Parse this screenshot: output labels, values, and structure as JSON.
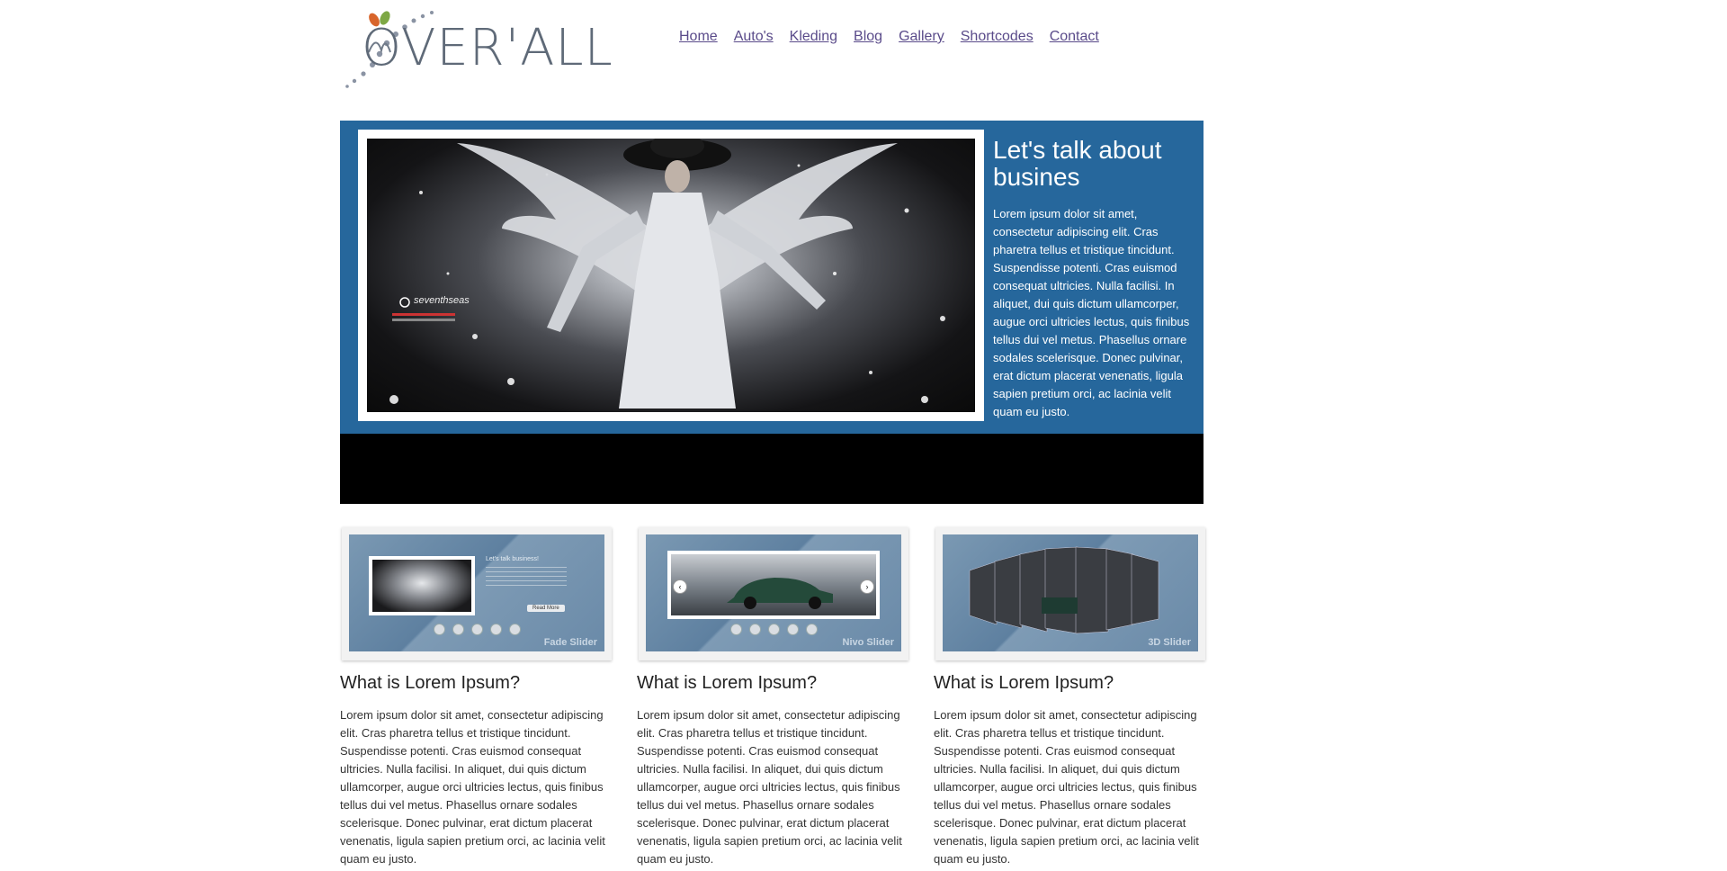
{
  "logo": {
    "text": "OVER'ALL"
  },
  "nav": {
    "items": [
      "Home",
      "Auto's",
      "Kleding",
      "Blog",
      "Gallery",
      "Shortcodes",
      "Contact"
    ]
  },
  "hero": {
    "title": "Let's talk about busines",
    "body": "Lorem ipsum dolor sit amet, consectetur adipiscing elit. Cras pharetra tellus et tristique tincidunt. Suspendisse potenti. Cras euismod consequat ultricies. Nulla facilisi. In aliquet, dui quis dictum ullamcorper, augue orci ultricies lectus, quis finibus tellus dui vel metus. Phasellus ornare sodales scelerisque. Donec pulvinar, erat dictum placerat venenatis, ligula sapien pretium orci, ac lacinia velit quam eu justo.",
    "image_watermark": "seventhseas",
    "colors": {
      "blue": "#26679c",
      "black": "#000000"
    }
  },
  "thumbs": [
    {
      "label": "Fade Slider",
      "mini_title": "Let's talk business!",
      "mini_button": "Read More"
    },
    {
      "label": "Nivo Slider"
    },
    {
      "label": "3D Slider"
    }
  ],
  "columns": [
    {
      "title": "What is Lorem Ipsum?",
      "body": "Lorem ipsum dolor sit amet, consectetur adipiscing elit. Cras pharetra tellus et tristique tincidunt. Suspendisse potenti. Cras euismod consequat ultricies. Nulla facilisi. In aliquet, dui quis dictum ullamcorper, augue orci ultricies lectus, quis finibus tellus dui vel metus. Phasellus ornare sodales scelerisque. Donec pulvinar, erat dictum placerat venenatis, ligula sapien pretium orci, ac lacinia velit quam eu justo."
    },
    {
      "title": "What is Lorem Ipsum?",
      "body": "Lorem ipsum dolor sit amet, consectetur adipiscing elit. Cras pharetra tellus et tristique tincidunt. Suspendisse potenti. Cras euismod consequat ultricies. Nulla facilisi. In aliquet, dui quis dictum ullamcorper, augue orci ultricies lectus, quis finibus tellus dui vel metus. Phasellus ornare sodales scelerisque. Donec pulvinar, erat dictum placerat venenatis, ligula sapien pretium orci, ac lacinia velit quam eu justo."
    },
    {
      "title": "What is Lorem Ipsum?",
      "body": "Lorem ipsum dolor sit amet, consectetur adipiscing elit. Cras pharetra tellus et tristique tincidunt. Suspendisse potenti. Cras euismod consequat ultricies. Nulla facilisi. In aliquet, dui quis dictum ullamcorper, augue orci ultricies lectus, quis finibus tellus dui vel metus. Phasellus ornare sodales scelerisque. Donec pulvinar, erat dictum placerat venenatis, ligula sapien pretium orci, ac lacinia velit quam eu justo."
    }
  ]
}
